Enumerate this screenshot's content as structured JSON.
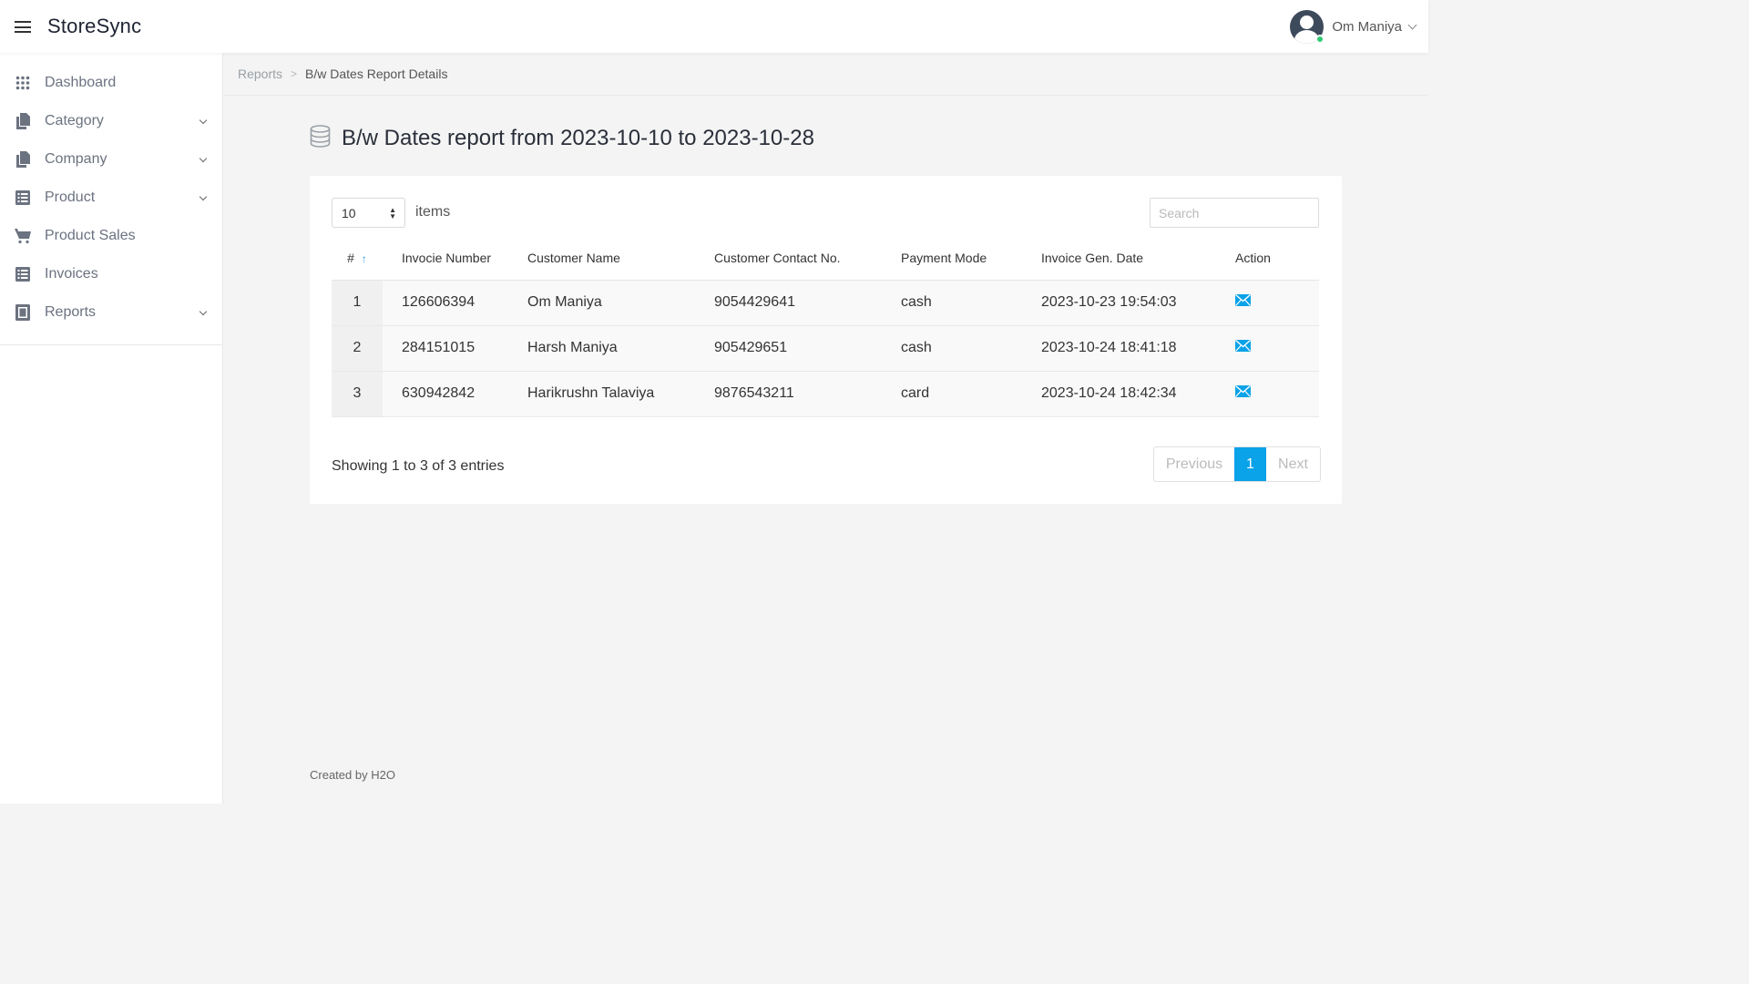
{
  "app": {
    "brand": "StoreSync"
  },
  "user": {
    "name": "Om Maniya"
  },
  "sidebar": {
    "items": [
      {
        "label": "Dashboard",
        "icon": "grid-icon",
        "expandable": false
      },
      {
        "label": "Category",
        "icon": "copy-icon",
        "expandable": true
      },
      {
        "label": "Company",
        "icon": "copy-icon",
        "expandable": true
      },
      {
        "label": "Product",
        "icon": "list-icon",
        "expandable": true
      },
      {
        "label": "Product Sales",
        "icon": "cart-icon",
        "expandable": false
      },
      {
        "label": "Invoices",
        "icon": "list-icon",
        "expandable": false
      },
      {
        "label": "Reports",
        "icon": "report-icon",
        "expandable": true
      }
    ]
  },
  "breadcrumb": {
    "parent": "Reports",
    "separator": ">",
    "current": "B/w Dates Report Details"
  },
  "page": {
    "title": "B/w Dates report from 2023-10-10 to 2023-10-28"
  },
  "table_controls": {
    "page_length": "10",
    "length_label": "items",
    "search_placeholder": "Search"
  },
  "table": {
    "columns": [
      "#",
      "Invocie Number",
      "Customer Name",
      "Customer Contact No.",
      "Payment Mode",
      "Invoice Gen. Date",
      "Action"
    ],
    "rows": [
      {
        "index": "1",
        "invoice": "126606394",
        "customer": "Om Maniya",
        "contact": "9054429641",
        "payment": "cash",
        "date": "2023-10-23 19:54:03"
      },
      {
        "index": "2",
        "invoice": "284151015",
        "customer": "Harsh Maniya",
        "contact": "905429651",
        "payment": "cash",
        "date": "2023-10-24 18:41:18"
      },
      {
        "index": "3",
        "invoice": "630942842",
        "customer": "Harikrushn Talaviya",
        "contact": "9876543211",
        "payment": "card",
        "date": "2023-10-24 18:42:34"
      }
    ],
    "action_icon": "mail-icon"
  },
  "pagination": {
    "info": "Showing 1 to 3 of 3 entries",
    "previous": "Previous",
    "current": "1",
    "next": "Next"
  },
  "footer": {
    "text": "Created by H2O"
  },
  "colors": {
    "accent": "#0aa2e8",
    "sort_arrow": "#3498db",
    "online": "#2ecc71"
  }
}
